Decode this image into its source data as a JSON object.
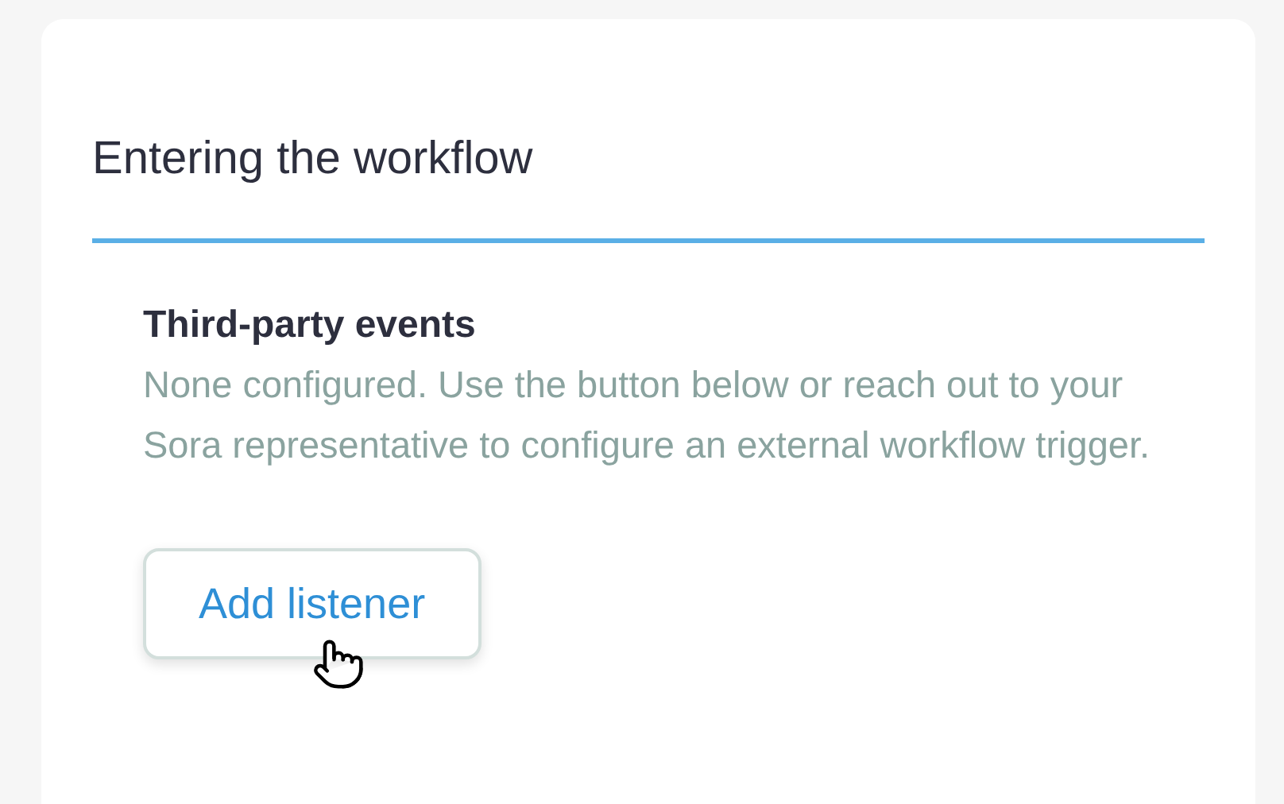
{
  "section": {
    "title": "Entering the workflow"
  },
  "group": {
    "title": "Third-party events",
    "description": "None configured. Use the button below or reach out to your Sora representative to configure an external workflow trigger.",
    "button": "Add listener"
  }
}
